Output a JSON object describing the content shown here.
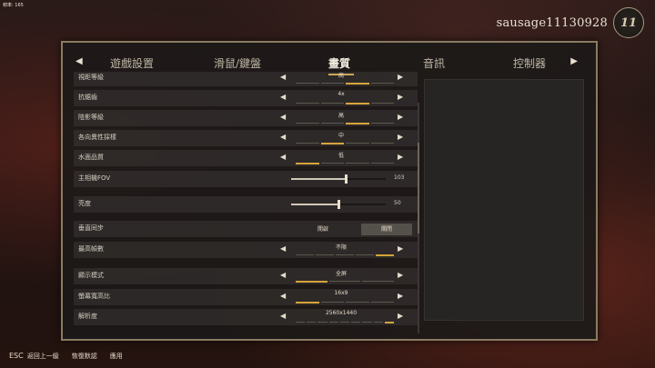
{
  "fps": "幀率: 165",
  "profile": {
    "username": "sausage11130928",
    "level": "11"
  },
  "tabs": [
    "遊戲設置",
    "滑鼠/鍵盤",
    "畫質",
    "音訊",
    "控制器"
  ],
  "active_tab": 2,
  "rows": [
    {
      "label": "視距等級",
      "kind": "select",
      "value": "高",
      "level": 0.75,
      "segs": 4
    },
    {
      "label": "抗鋸齒",
      "kind": "select",
      "value": "4x",
      "level": 0.75,
      "segs": 4
    },
    {
      "label": "陰影等級",
      "kind": "select",
      "value": "高",
      "level": 0.75,
      "segs": 4
    },
    {
      "label": "各向異性採樣",
      "kind": "select",
      "value": "中",
      "level": 0.5,
      "segs": 4
    },
    {
      "label": "水面品質",
      "kind": "select",
      "value": "低",
      "level": 0.25,
      "segs": 4
    },
    {
      "label": "主相機FOV",
      "kind": "slider",
      "value": "103",
      "level": 0.58
    },
    {
      "label": "亮度",
      "kind": "slider",
      "value": "50",
      "level": 0.5
    },
    {
      "label": "垂直同步",
      "kind": "toggle",
      "off_label": "開啟",
      "on_label": "關閉"
    },
    {
      "label": "最高幀數",
      "kind": "select",
      "value": "不限",
      "level": 1.0,
      "segs": 5
    },
    {
      "label": "顯示模式",
      "kind": "select",
      "value": "全屏",
      "level": 0.33,
      "segs": 3
    },
    {
      "label": "螢幕寬高比",
      "kind": "select",
      "value": "16x9",
      "level": 0.25,
      "segs": 4
    },
    {
      "label": "解析度",
      "kind": "select",
      "value": "2560x1440",
      "level": 1.0,
      "segs": 9
    }
  ],
  "footer": {
    "esc_key": "ESC",
    "back": "返回上一級",
    "reset": "恢復默認",
    "apply": "應用"
  },
  "colors": {
    "accent": "#d6a43c",
    "frame": "#8a7c62"
  }
}
